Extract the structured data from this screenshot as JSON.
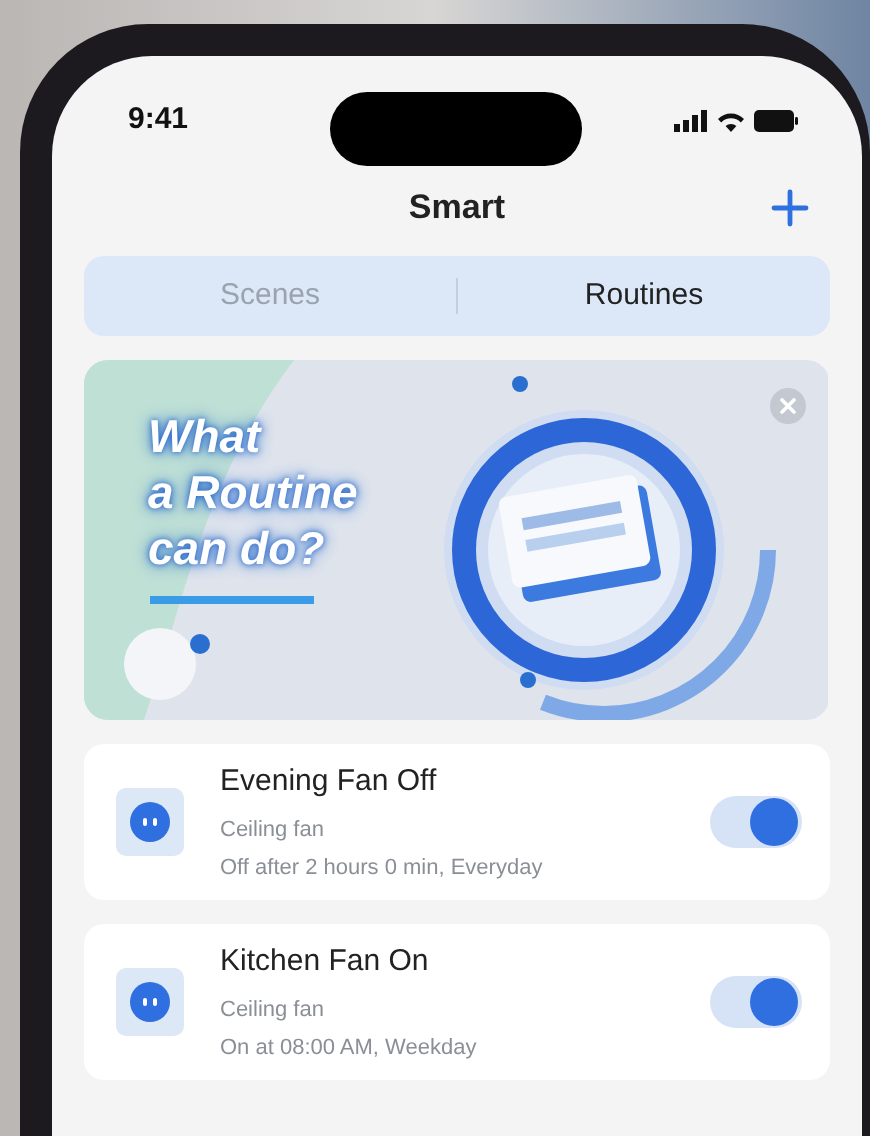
{
  "status_bar": {
    "time": "9:41"
  },
  "header": {
    "title": "Smart"
  },
  "tabs": [
    {
      "label": "Scenes",
      "selected": false
    },
    {
      "label": "Routines",
      "selected": true
    }
  ],
  "banner": {
    "headline_lines": [
      "What",
      "a Routine",
      "can do?"
    ]
  },
  "routines": [
    {
      "name": "Evening Fan Off",
      "device": "Ceiling fan",
      "schedule": "Off after 2 hours 0 min, Everyday",
      "on": true
    },
    {
      "name": "Kitchen Fan On",
      "device": "Ceiling fan",
      "schedule": "On at 08:00 AM, Weekday",
      "on": true
    }
  ]
}
